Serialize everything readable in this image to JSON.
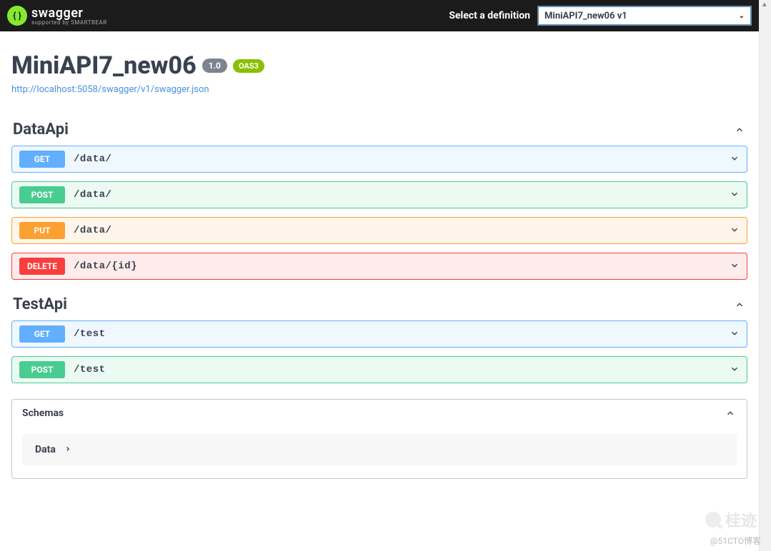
{
  "header": {
    "logo_text": "swagger",
    "logo_sub": "supported by SMARTBEAR",
    "definition_label": "Select a definition",
    "definition_selected": "MiniAPI7_new06 v1"
  },
  "info": {
    "title": "MiniAPI7_new06",
    "version": "1.0",
    "oas_badge": "OAS3",
    "url": "http://localhost:5058/swagger/v1/swagger.json"
  },
  "tags": [
    {
      "name": "DataApi",
      "operations": [
        {
          "method": "GET",
          "path": "/data/",
          "css": "op-get"
        },
        {
          "method": "POST",
          "path": "/data/",
          "css": "op-post"
        },
        {
          "method": "PUT",
          "path": "/data/",
          "css": "op-put"
        },
        {
          "method": "DELETE",
          "path": "/data/{id}",
          "css": "op-delete"
        }
      ]
    },
    {
      "name": "TestApi",
      "operations": [
        {
          "method": "GET",
          "path": "/test",
          "css": "op-get"
        },
        {
          "method": "POST",
          "path": "/test",
          "css": "op-post"
        }
      ]
    }
  ],
  "schemas": {
    "title": "Schemas",
    "items": [
      {
        "name": "Data"
      }
    ]
  },
  "watermark": {
    "text": "@51CTO博客",
    "logo": "桂迹"
  }
}
